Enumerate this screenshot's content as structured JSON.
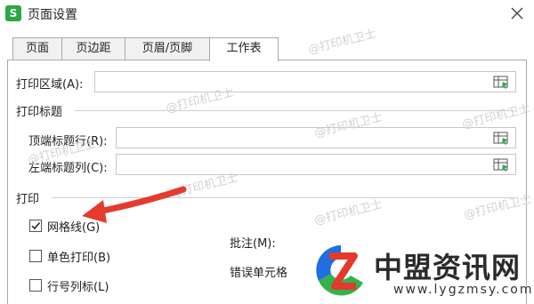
{
  "window": {
    "app_icon_letter": "S",
    "title": "页面设置"
  },
  "tabs": [
    {
      "label": "页面"
    },
    {
      "label": "页边距"
    },
    {
      "label": "页眉/页脚"
    },
    {
      "label": "工作表",
      "active": true
    }
  ],
  "print_area": {
    "label": "打印区域(A):",
    "value": ""
  },
  "print_titles": {
    "section": "打印标题",
    "top_rows": {
      "label": "顶端标题行(R):",
      "value": ""
    },
    "left_cols": {
      "label": "左端标题列(C):",
      "value": ""
    }
  },
  "print": {
    "section": "打印",
    "gridlines": {
      "label": "网格线(G)",
      "checked": true
    },
    "mono": {
      "label": "单色打印(B)",
      "checked": false
    },
    "headings": {
      "label": "行号列标(L)",
      "checked": false
    },
    "comments_label": "批注(M):",
    "errors_label": "错误单元格"
  },
  "watermark_text": "@打印机卫士",
  "brand": {
    "name": "中盟资讯网",
    "url": "www.lygzmsy.com"
  },
  "colors": {
    "app_icon": "#2aa845",
    "arrow": "#e53b2f",
    "brand_blue": "#1f6fe0",
    "brand_green": "#35b24a",
    "brand_red": "#e23a2d"
  }
}
